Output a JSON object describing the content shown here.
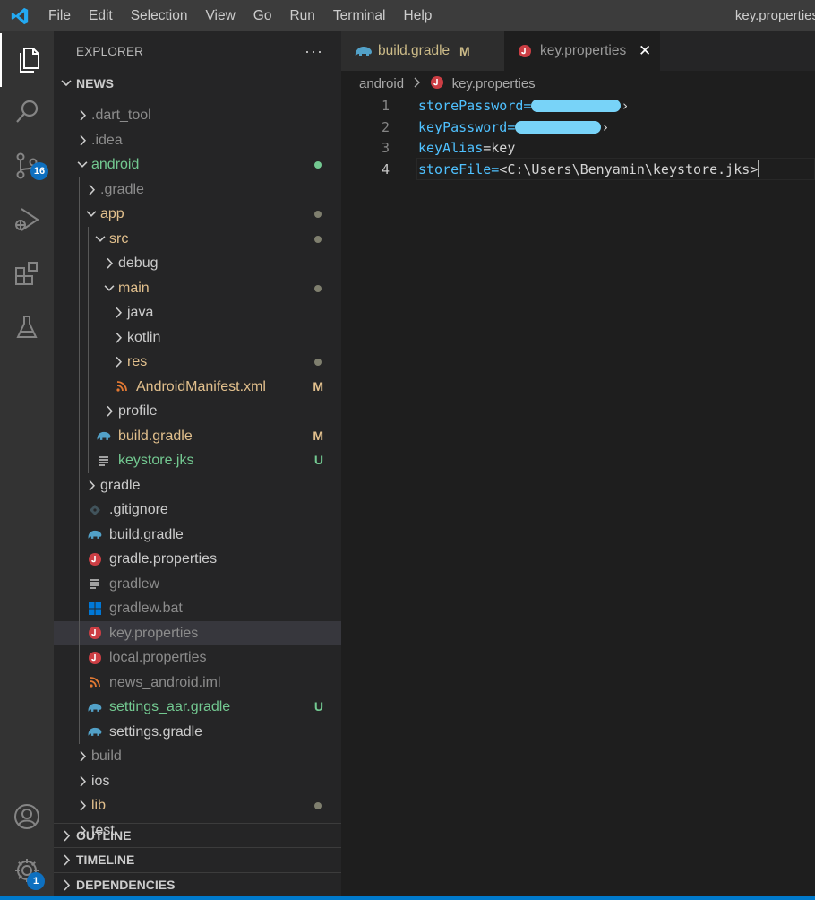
{
  "menu": {
    "items": [
      "File",
      "Edit",
      "Selection",
      "View",
      "Go",
      "Run",
      "Terminal",
      "Help"
    ],
    "window_title": "key.properties"
  },
  "activity": {
    "source_control_badge": "16",
    "settings_badge": "1"
  },
  "sidebar": {
    "title": "EXPLORER",
    "more": "···",
    "root": "NEWS",
    "tree": [
      {
        "label": ".dart_tool",
        "kind": "folder",
        "expanded": false,
        "status": null
      },
      {
        "label": ".idea",
        "kind": "folder",
        "expanded": false,
        "status": null
      },
      {
        "label": "android",
        "kind": "folder",
        "expanded": true,
        "status": "dot-green"
      },
      {
        "label": ".gradle",
        "kind": "folder",
        "expanded": false,
        "status": null
      },
      {
        "label": "app",
        "kind": "folder",
        "expanded": true,
        "status": "dot"
      },
      {
        "label": "src",
        "kind": "folder",
        "expanded": true,
        "status": "dot"
      },
      {
        "label": "debug",
        "kind": "folder",
        "expanded": false,
        "status": null
      },
      {
        "label": "main",
        "kind": "folder",
        "expanded": true,
        "status": "dot"
      },
      {
        "label": "java",
        "kind": "folder",
        "expanded": false,
        "status": null
      },
      {
        "label": "kotlin",
        "kind": "folder",
        "expanded": false,
        "status": null
      },
      {
        "label": "res",
        "kind": "folder",
        "expanded": false,
        "status": "dot"
      },
      {
        "label": "AndroidManifest.xml",
        "kind": "xml",
        "status": "M"
      },
      {
        "label": "profile",
        "kind": "folder",
        "expanded": false,
        "status": null
      },
      {
        "label": "build.gradle",
        "kind": "gradle",
        "status": "M"
      },
      {
        "label": "keystore.jks",
        "kind": "text",
        "status": "U"
      },
      {
        "label": "gradle",
        "kind": "folder",
        "expanded": false,
        "status": null
      },
      {
        "label": ".gitignore",
        "kind": "git",
        "status": null
      },
      {
        "label": "build.gradle",
        "kind": "gradle",
        "status": null
      },
      {
        "label": "gradle.properties",
        "kind": "java",
        "status": null
      },
      {
        "label": "gradlew",
        "kind": "text",
        "status": null
      },
      {
        "label": "gradlew.bat",
        "kind": "windows",
        "status": null
      },
      {
        "label": "key.properties",
        "kind": "java",
        "status": null
      },
      {
        "label": "local.properties",
        "kind": "java",
        "status": null
      },
      {
        "label": "news_android.iml",
        "kind": "xml",
        "status": null
      },
      {
        "label": "settings_aar.gradle",
        "kind": "gradle",
        "status": "U"
      },
      {
        "label": "settings.gradle",
        "kind": "gradle",
        "status": null
      },
      {
        "label": "build",
        "kind": "folder",
        "expanded": false,
        "status": null
      },
      {
        "label": "ios",
        "kind": "folder",
        "expanded": false,
        "status": null
      },
      {
        "label": "lib",
        "kind": "folder",
        "expanded": false,
        "status": "dot"
      },
      {
        "label": "test",
        "kind": "folder",
        "expanded": false,
        "status": null
      }
    ],
    "sections": [
      "OUTLINE",
      "TIMELINE",
      "DEPENDENCIES"
    ]
  },
  "editor": {
    "tabs": [
      {
        "label": "build.gradle",
        "status": "M"
      },
      {
        "label": "key.properties",
        "close": "✕"
      }
    ],
    "breadcrumb": [
      "android",
      "key.properties"
    ],
    "lines": [
      {
        "num": "1",
        "key": "storePassword",
        "eq": "=",
        "value": ""
      },
      {
        "num": "2",
        "key": "keyPassword",
        "eq": "=",
        "value": ""
      },
      {
        "num": "3",
        "key": "keyAlias",
        "eq": "=",
        "value": "key"
      },
      {
        "num": "4",
        "key": "storeFile",
        "eq": "=",
        "value": "<C:\\Users\\Benyamin\\keystore.jks>"
      }
    ]
  },
  "colors": {
    "accent": "#007acc",
    "modified": "#e2c08d",
    "untracked": "#73c991",
    "code_key": "#4fc1ff",
    "redaction": "#78d3f8"
  }
}
